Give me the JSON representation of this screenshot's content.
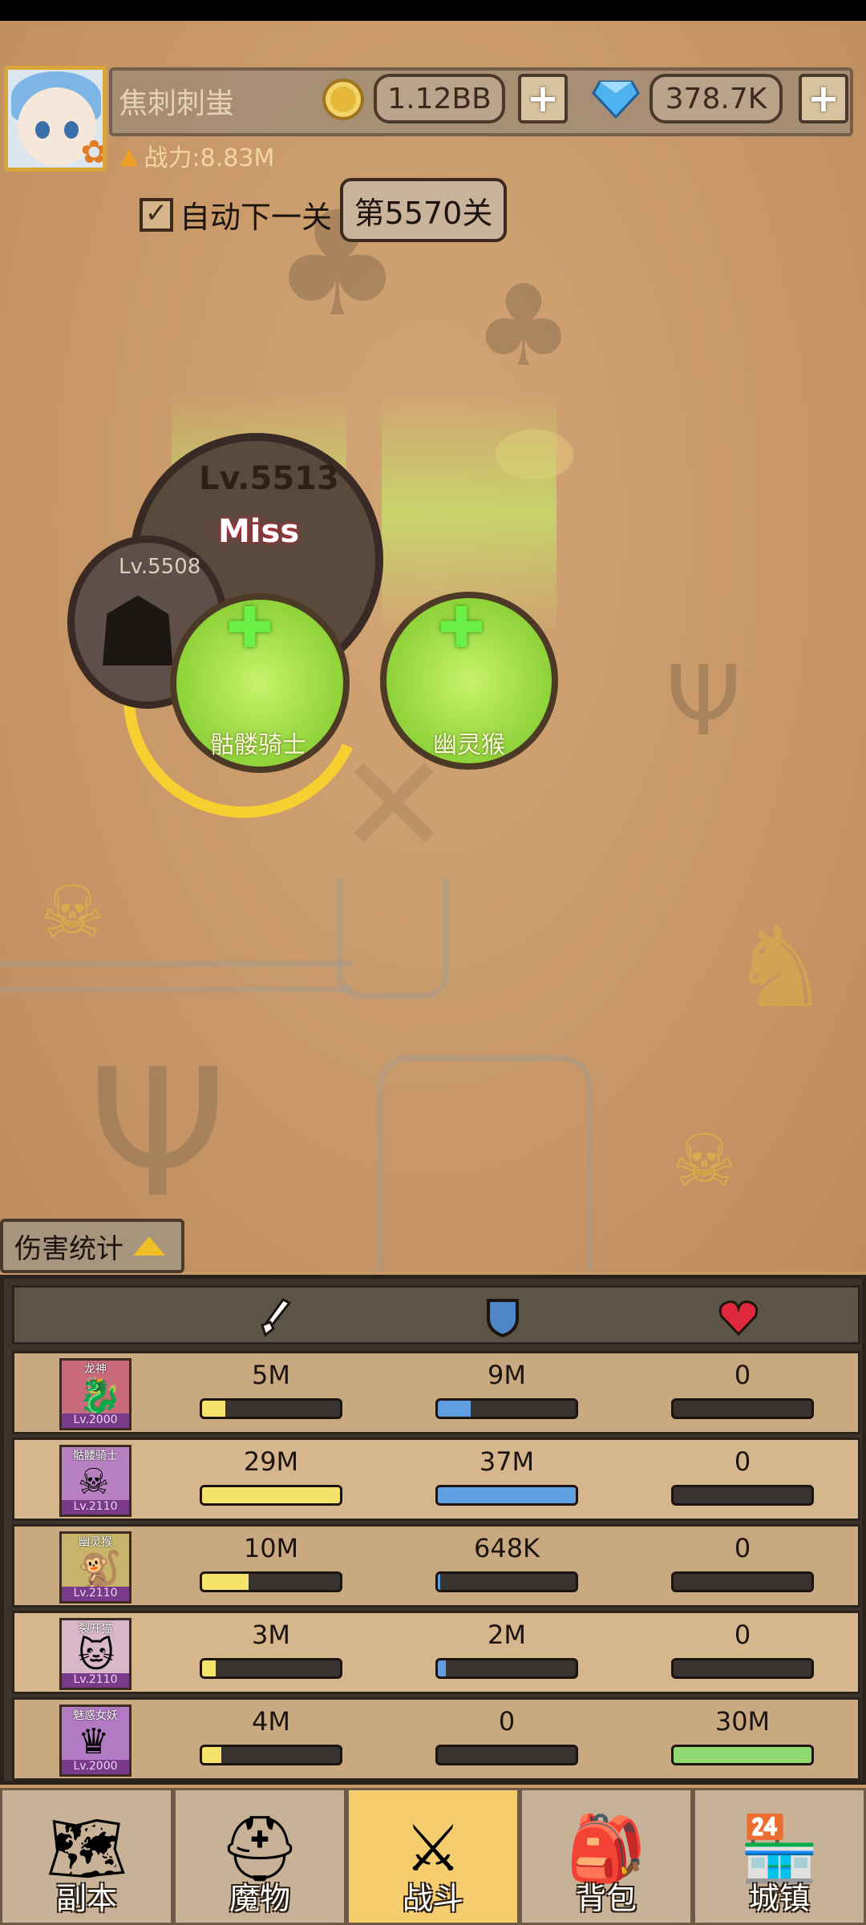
{
  "header": {
    "player_name": "焦刺刺蚩",
    "power": "战力:8.83M",
    "gold": "1.12BB",
    "gems": "378.7K",
    "auto_next_label": "自动下一关",
    "auto_next_checked": "✓",
    "stage": "第5570关"
  },
  "battle": {
    "enemy_boss_level": "Lv.5513",
    "miss_text": "Miss",
    "enemy_bear_level": "Lv.5508",
    "ally_1_name": "骷髅骑士",
    "ally_2_name": "幽灵猴"
  },
  "damage_panel": {
    "tab_label": "伤害统计",
    "column_icons": [
      "sword-icon",
      "shield-icon",
      "heart-icon"
    ],
    "rows": [
      {
        "name": "龙神",
        "level": "Lv.2000",
        "attack": "5M",
        "attack_fill": 0.17,
        "defense": "9M",
        "defense_fill": 0.24,
        "heal": "0",
        "heal_fill": 0
      },
      {
        "name": "骷髅骑士",
        "level": "Lv.2110",
        "attack": "29M",
        "attack_fill": 1.0,
        "defense": "37M",
        "defense_fill": 1.0,
        "heal": "0",
        "heal_fill": 0
      },
      {
        "name": "幽灵猴",
        "level": "Lv.2110",
        "attack": "10M",
        "attack_fill": 0.34,
        "defense": "648K",
        "defense_fill": 0.02,
        "heal": "0",
        "heal_fill": 0
      },
      {
        "name": "裂开猫",
        "level": "Lv.2110",
        "attack": "3M",
        "attack_fill": 0.1,
        "defense": "2M",
        "defense_fill": 0.06,
        "heal": "0",
        "heal_fill": 0
      },
      {
        "name": "魅惑女妖",
        "level": "Lv.2000",
        "attack": "4M",
        "attack_fill": 0.14,
        "defense": "0",
        "defense_fill": 0,
        "heal": "30M",
        "heal_fill": 1.0
      }
    ],
    "colors": {
      "attack": "#f5e36c",
      "defense": "#5f9ee0",
      "heal": "#8fd870"
    }
  },
  "nav": {
    "items": [
      {
        "label": "副本",
        "icon": "map-icon"
      },
      {
        "label": "魔物",
        "icon": "helmet-icon"
      },
      {
        "label": "战斗",
        "icon": "crossed-swords-icon"
      },
      {
        "label": "背包",
        "icon": "backpack-icon"
      },
      {
        "label": "城镇",
        "icon": "shop-icon"
      }
    ],
    "active_index": 2
  }
}
